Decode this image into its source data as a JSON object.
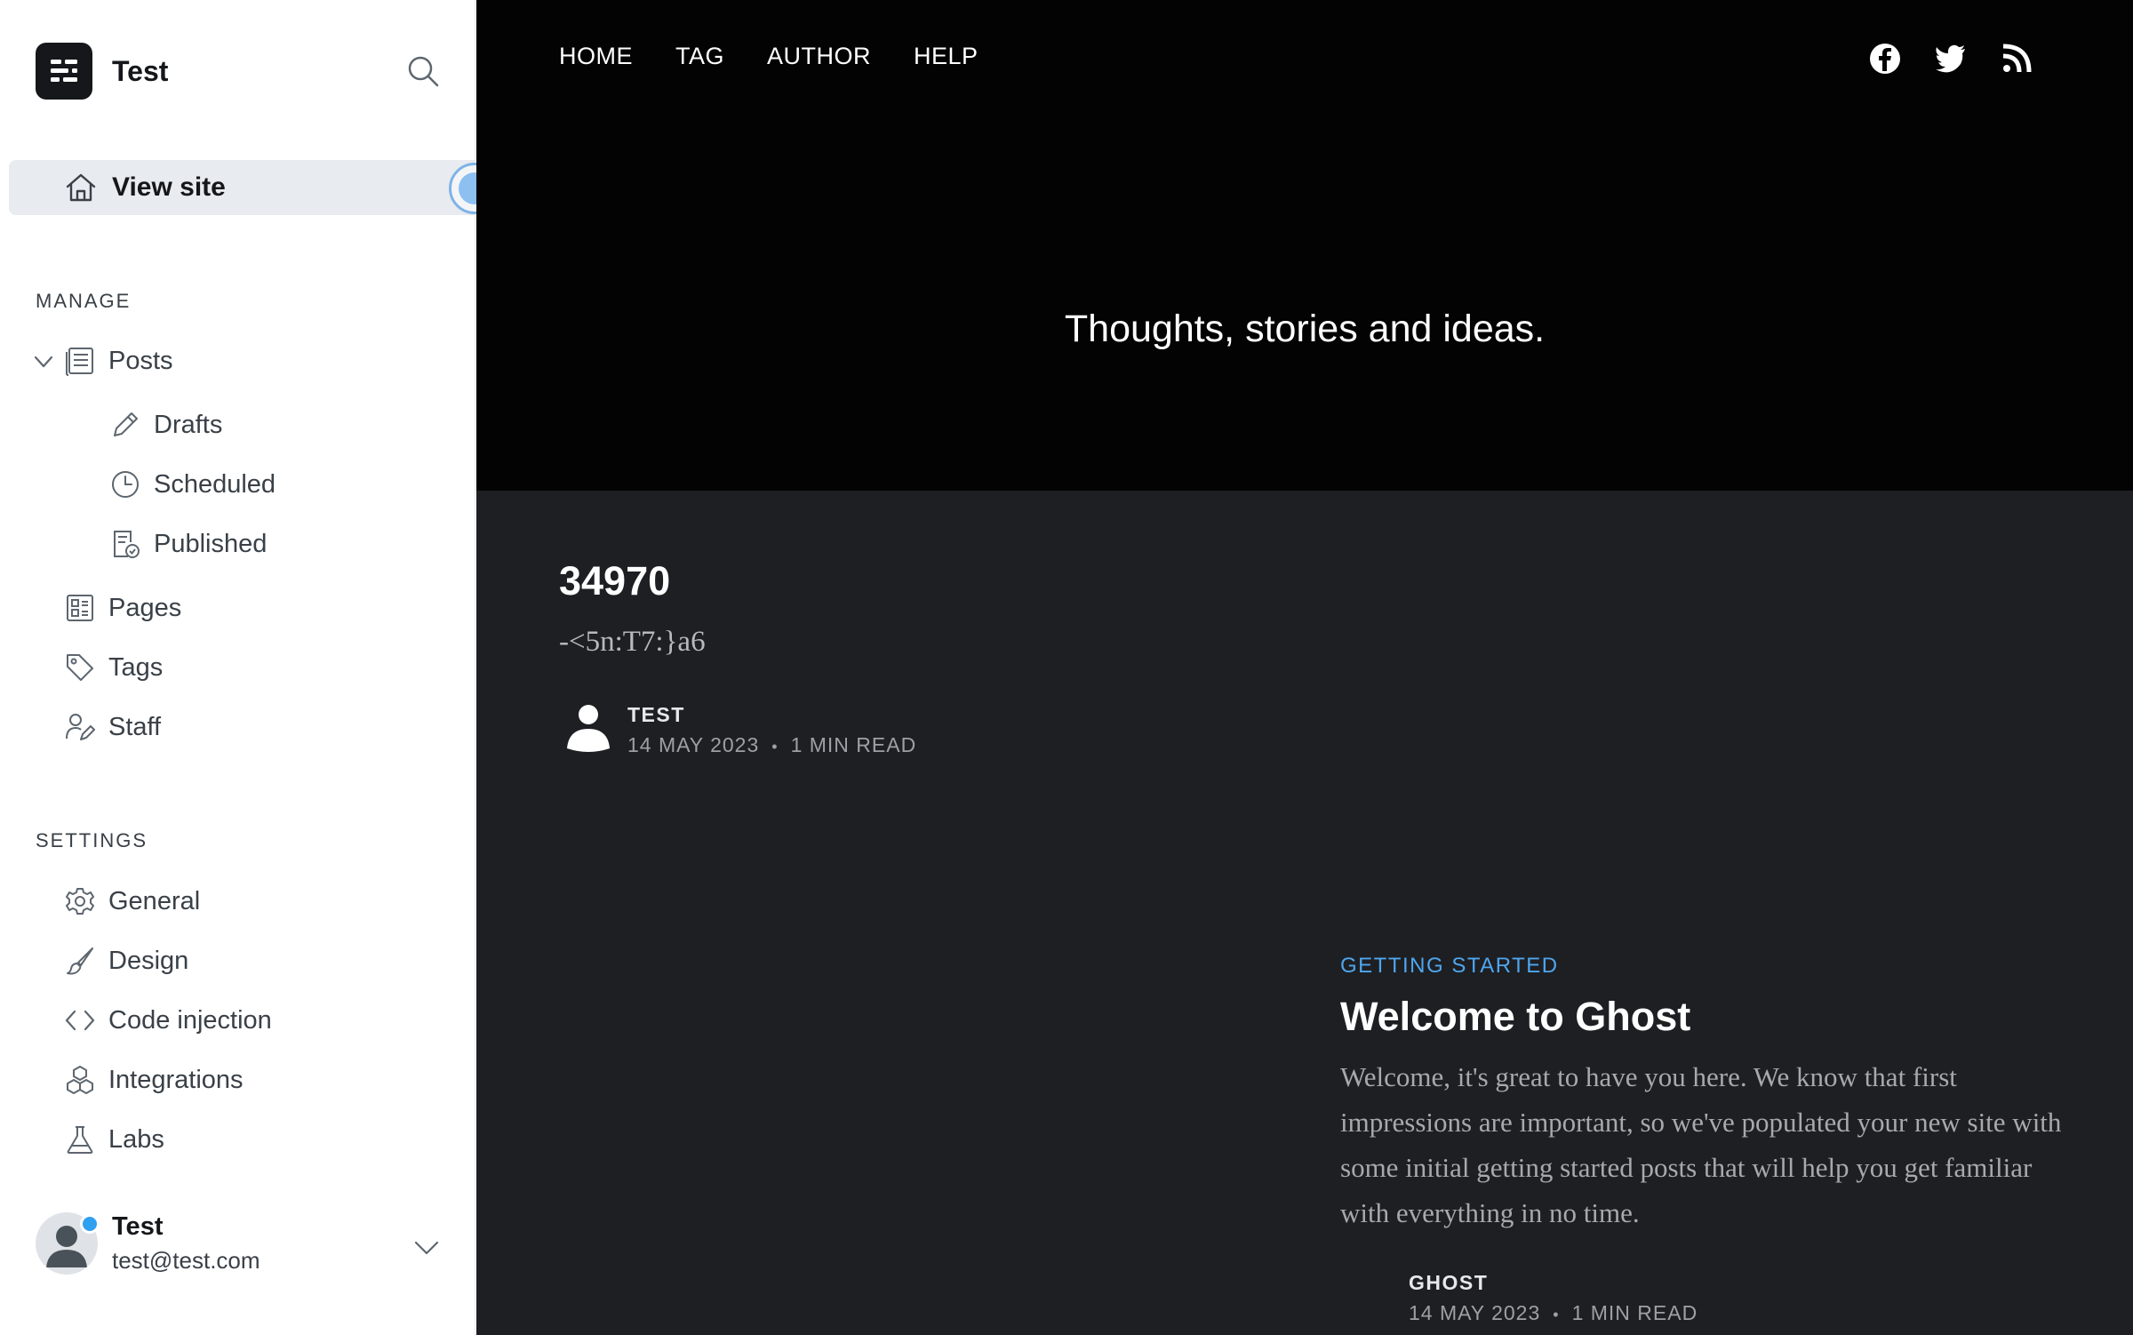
{
  "sidebar": {
    "site_name": "Test",
    "view_site": "View site",
    "manage_heading": "MANAGE",
    "settings_heading": "SETTINGS",
    "manage_items": [
      {
        "label": "Posts",
        "icon": "posts-icon"
      },
      {
        "label": "Drafts",
        "icon": "pencil-icon"
      },
      {
        "label": "Scheduled",
        "icon": "clock-icon"
      },
      {
        "label": "Published",
        "icon": "published-icon"
      },
      {
        "label": "Pages",
        "icon": "pages-icon"
      },
      {
        "label": "Tags",
        "icon": "tag-icon"
      },
      {
        "label": "Staff",
        "icon": "staff-icon"
      }
    ],
    "settings_items": [
      {
        "label": "General",
        "icon": "gear-icon"
      },
      {
        "label": "Design",
        "icon": "brush-icon"
      },
      {
        "label": "Code injection",
        "icon": "code-icon"
      },
      {
        "label": "Integrations",
        "icon": "integrations-icon"
      },
      {
        "label": "Labs",
        "icon": "flask-icon"
      }
    ],
    "user": {
      "name": "Test",
      "email": "test@test.com"
    }
  },
  "site": {
    "nav": [
      "HOME",
      "TAG",
      "AUTHOR",
      "HELP"
    ],
    "tagline": "Thoughts, stories and ideas.",
    "posts": [
      {
        "title": "34970",
        "excerpt": "-<5n:T7:}a6",
        "author": "TEST",
        "date": "14 MAY 2023",
        "read": "1 MIN READ"
      },
      {
        "tag": "GETTING STARTED",
        "title": "Welcome to Ghost",
        "excerpt": "Welcome, it's great to have you here. We know that first impressions are important, so we've populated your new site with some initial getting started posts that will help you get familiar with everything in no time.",
        "author": "GHOST",
        "date": "14 MAY 2023",
        "read": "1 MIN READ"
      }
    ],
    "sep": "•"
  },
  "colors": {
    "accent": "#4ea6ee",
    "hero_bg": "#030303",
    "content_bg": "#1e1f23",
    "sidebar_active": "#e8ebef"
  }
}
